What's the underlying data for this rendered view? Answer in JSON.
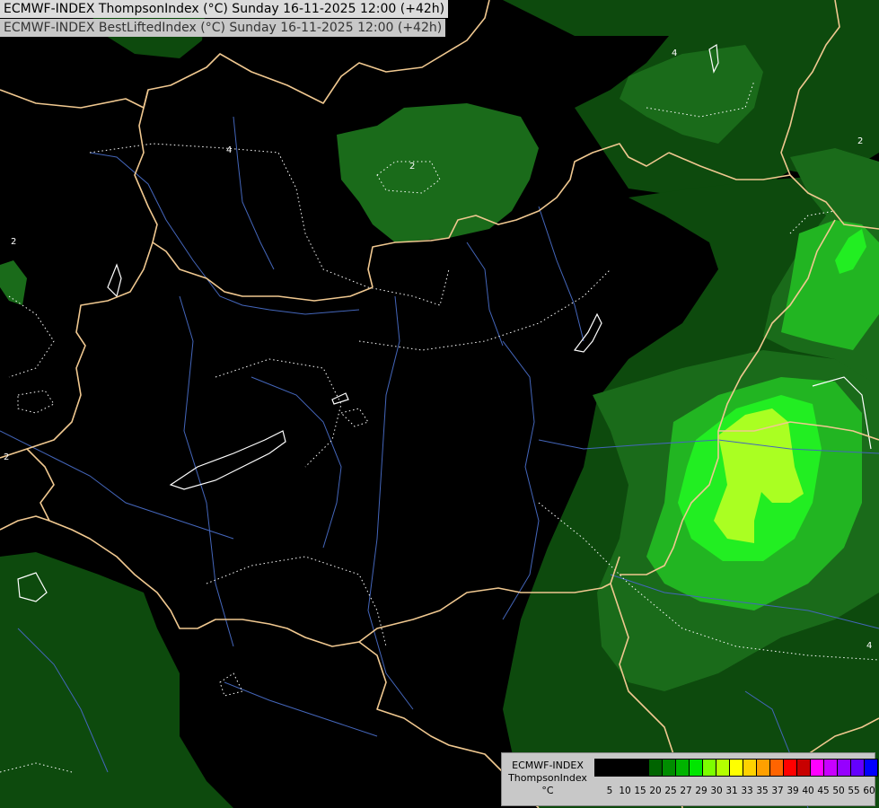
{
  "header": {
    "line1": "ECMWF-INDEX ThompsonIndex (°C) Sunday 16-11-2025 12:00 (+42h)",
    "line2": "ECMWF-INDEX BestLiftedIndex (°C) Sunday 16-11-2025 12:00 (+42h)"
  },
  "contour_labels": [
    "4",
    "2",
    "2",
    "2",
    "2",
    "4",
    "4"
  ],
  "legend": {
    "title_line1": "ECMWF-INDEX",
    "title_line2": "ThompsonIndex",
    "unit": "°C",
    "tick_labels": [
      "5",
      "10",
      "15",
      "20",
      "25",
      "27",
      "29",
      "30",
      "31",
      "33",
      "35",
      "37",
      "39",
      "40",
      "45",
      "50",
      "55",
      "60"
    ],
    "colors": [
      "#000000",
      "#000000",
      "#000000",
      "#000000",
      "#006400",
      "#008c00",
      "#00b400",
      "#00e600",
      "#7cff00",
      "#b4ff00",
      "#ffff00",
      "#ffd200",
      "#ffa000",
      "#ff6400",
      "#ff0000",
      "#c80000",
      "#ff00ff",
      "#c800ff",
      "#9600ff",
      "#6400ff",
      "#0000ff"
    ]
  },
  "map_colors": {
    "background": "#000000",
    "green_dark": "#0d4a0d",
    "green_mid": "#1a6b1a",
    "green_bright": "#22b522",
    "green_lime": "#22ee22",
    "yellow_green": "#aaff22",
    "border": "#f0c890",
    "river": "#4466bb",
    "contour": "#ffffff"
  }
}
